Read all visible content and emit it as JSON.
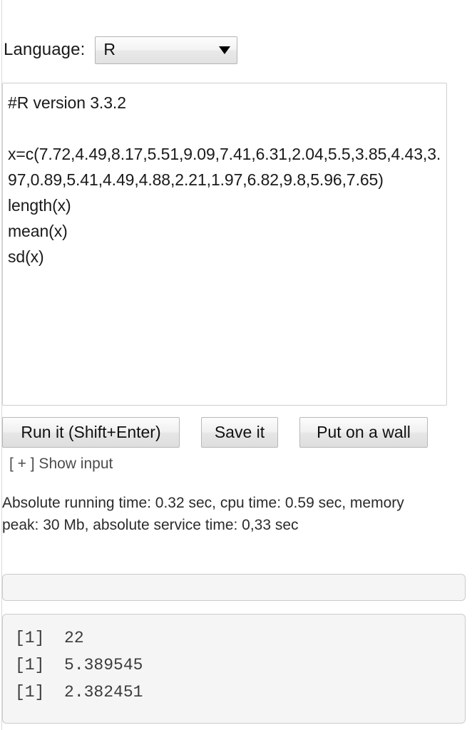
{
  "language": {
    "label": "Language:",
    "selected": "R",
    "caret_icon": "chevron-down-icon"
  },
  "editor": {
    "code": "#R version 3.3.2\n\nx=c(7.72,4.49,8.17,5.51,9.09,7.41,6.31,2.04,5.5,3.85,4.43,3.97,0.89,5.41,4.49,4.88,2.21,1.97,6.82,9.8,5.96,7.65)\nlength(x)\nmean(x)\nsd(x)"
  },
  "buttons": {
    "run": "Run it (Shift+Enter)",
    "save": "Save it",
    "wall": "Put on a wall"
  },
  "show_input": {
    "label": "[ + ] Show input"
  },
  "status": {
    "running_time": "Absolute running time: 0.32 sec, cpu time: 0.59 sec, memory peak: 30 Mb, absolute service time: 0,33 sec"
  },
  "stdin_panel": {
    "content": ""
  },
  "output_panel": {
    "content": "[1]  22\n[1]  5.389545\n[1]  2.382451"
  },
  "colors": {
    "page_background": "#ffffff",
    "panel_background": "#f5f5f5",
    "panel_border": "#cccccc",
    "editor_border": "#cfcfcf",
    "button_border": "#b8b8b8",
    "text": "#1a1a1a",
    "muted_text": "#4c4c4c"
  }
}
